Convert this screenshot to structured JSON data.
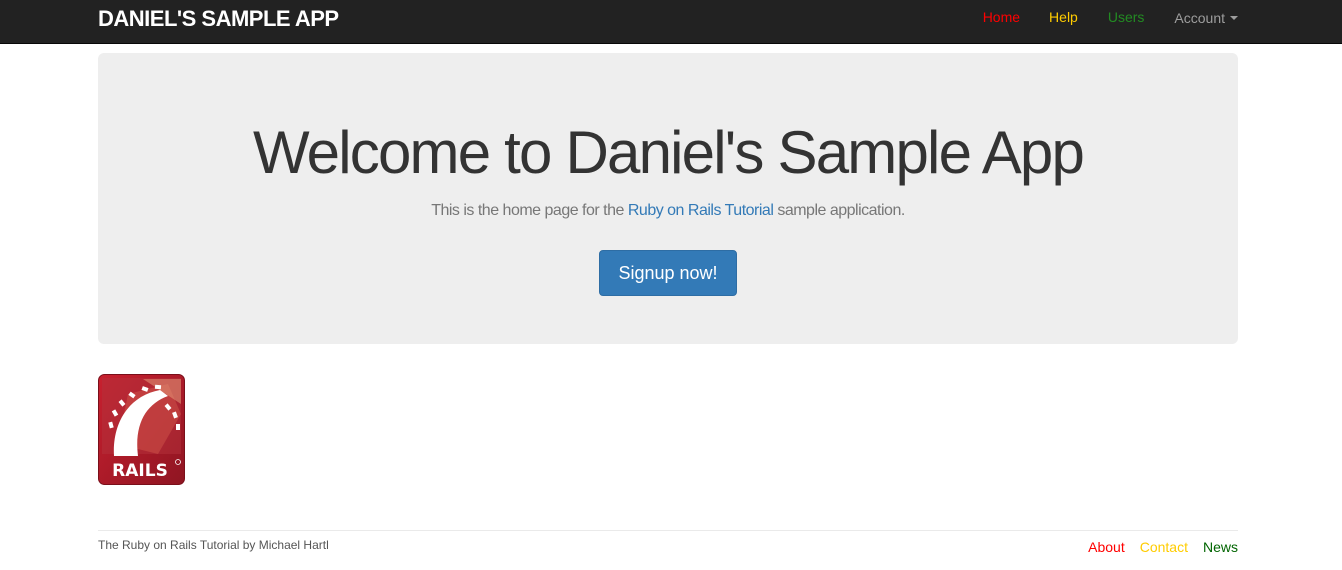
{
  "header": {
    "brand": "DANIEL'S SAMPLE APP",
    "nav": {
      "home": "Home",
      "help": "Help",
      "users": "Users",
      "account": "Account"
    }
  },
  "hero": {
    "title": "Welcome to Daniel's Sample App",
    "subtitle_before": "This is the home page for the ",
    "subtitle_link": "Ruby on Rails Tutorial",
    "subtitle_after": " sample application.",
    "cta": "Signup now!"
  },
  "logo": {
    "text": "RAILS",
    "icon": "rails-logo"
  },
  "footer": {
    "prefix": "The ",
    "tutorial_link": "Ruby on Rails Tutorial",
    "by": " by ",
    "author_link": "Michael Hartl",
    "links": {
      "about": "About",
      "contact": "Contact",
      "news": "News"
    }
  },
  "colors": {
    "navbar": "#222222",
    "home": "#ff0000",
    "help": "#ffcc00",
    "users": "#228b22",
    "button": "#337ab7",
    "news": "#006400"
  }
}
